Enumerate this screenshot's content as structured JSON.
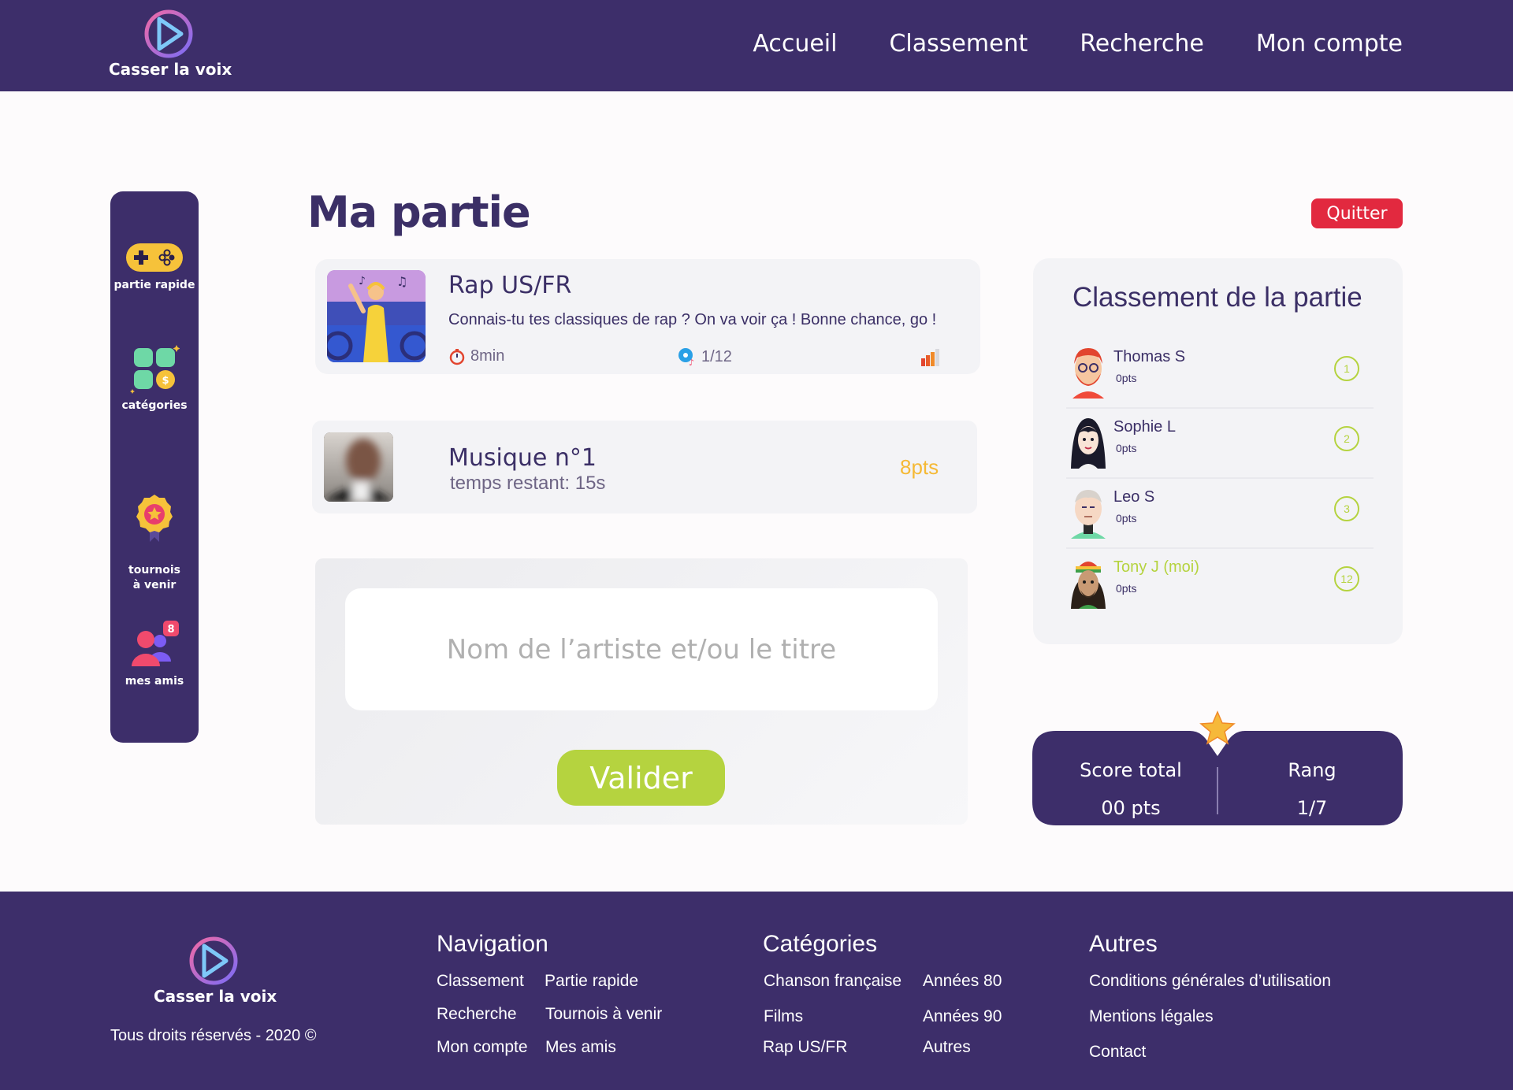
{
  "app": {
    "name": "Casser la voix"
  },
  "nav": {
    "items": [
      "Accueil",
      "Classement",
      "Recherche",
      "Mon compte"
    ]
  },
  "sidebar": {
    "items": [
      {
        "label": "partie rapide",
        "icon": "gamepad-icon"
      },
      {
        "label": "catégories",
        "icon": "categories-icon"
      },
      {
        "label": "tournois\nà venir",
        "icon": "medal-icon"
      },
      {
        "label": "mes amis",
        "icon": "friends-icon",
        "badge": "8"
      }
    ]
  },
  "page": {
    "title": "Ma partie",
    "quit_label": "Quitter"
  },
  "category_card": {
    "name": "Rap US/FR",
    "description": "Connais-tu tes classiques de rap ? On va voir ça ! Bonne chance, go !",
    "duration": "8min",
    "progress": "1/12",
    "difficulty_level": 3
  },
  "music_card": {
    "title": "Musique n°1",
    "time_left": "temps restant: 15s",
    "points": "8pts"
  },
  "answer": {
    "placeholder": "Nom de l’artiste et/ou le titre",
    "submit_label": "Valider"
  },
  "ranking": {
    "title": "Classement de la partie",
    "players": [
      {
        "name": "Thomas S",
        "points": "0pts",
        "rank": "1",
        "me": false
      },
      {
        "name": "Sophie L",
        "points": "0pts",
        "rank": "2",
        "me": false
      },
      {
        "name": "Leo S",
        "points": "0pts",
        "rank": "3",
        "me": false
      },
      {
        "name": "Tony J (moi)",
        "points": "0pts",
        "rank": "12",
        "me": true
      }
    ]
  },
  "score": {
    "total_label": "Score total",
    "total_value": "00 pts",
    "rank_label": "Rang",
    "rank_value": "1/7"
  },
  "footer": {
    "copyright": "Tous droits réservés - 2020 ©",
    "navigation": {
      "title": "Navigation",
      "links": [
        "Classement",
        "Partie rapide",
        "Recherche",
        "Tournois à venir",
        "Mon compte",
        "Mes amis"
      ]
    },
    "categories": {
      "title": "Catégories",
      "links": [
        "Chanson française",
        "Années 80",
        "Films",
        "Années 90",
        "Rap US/FR",
        "Autres"
      ]
    },
    "others": {
      "title": "Autres",
      "links": [
        "Conditions générales d’utilisation",
        "Mentions légales",
        "Contact"
      ]
    }
  },
  "colors": {
    "primary": "#3d2e6a",
    "accent_green": "#b5d33f",
    "danger": "#e2293f",
    "points_yellow": "#f5b935"
  }
}
